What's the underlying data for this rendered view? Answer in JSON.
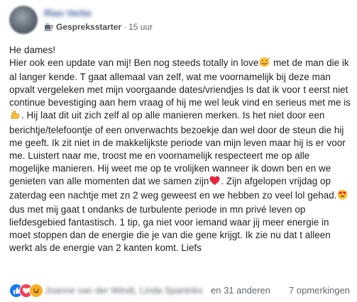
{
  "post": {
    "author_name": "Rian Verbeeten",
    "group_badge": "Gespreksstarter",
    "separator": "·",
    "time": "15 uur",
    "greeting": "He dames!",
    "paragraph_parts": [
      "Hier ook een update van mij! Ben nog steeds totally in love",
      " met de man die ik al langer kende. T gaat allemaal van zelf, wat me voornamelijk bij deze man opvalt vergeleken met mijn voorgaande dates/vriendjes Is dat ik voor t eerst niet continue bevestiging aan hem vraag of hij me wel leuk vind en serieus met me is",
      ". Hij laat dit uit zich zelf al op alle manieren merken. Is het niet door een berichtje/telefoontje of een onverwachts bezoekje dan wel door de steun die hij me geeft. Ik zit niet in de makkelijkste periode van mijn leven maar hij is er voor me. Luistert naar me, troost me en voornamelijk respecteert me op alle mogelijke manieren. Hij weet me op te vrolijken wanneer ik down ben en we genieten van alle momenten dat we samen zijn",
      ". Zijn afgelopen vrijdag op zaterdag een nachtje met zn 2 weg geweest en we hebben zo veel lol gehad.",
      " dus met mij gaat t ondanks de turbulente periode in mn privé leven op liefdesgebied fantastisch. 1 tip, ga niet voor iemand waar jij meer energie in moet stoppen dan de energie die je van die gene krijgt. Ik zie nu dat t alleen werkt als de energie van 2 kanten komt. Liefs"
    ]
  },
  "emojis": [
    "smiling-face-with-hearts",
    "flexed-biceps",
    "red-heart",
    "heart-eyes-face"
  ],
  "footer": {
    "reactions": [
      "like",
      "love",
      "haha"
    ],
    "reactor_names": "Joanne van der Windt, Linda Spaninks",
    "others_text": "en 31 anderen",
    "comments_text": "7 opmerkingen"
  },
  "colors": {
    "link": "#385898",
    "text": "#1c1e21",
    "muted": "#606770",
    "like": "#1877f2",
    "love": "#f33e58",
    "haha": "#f7b125"
  }
}
